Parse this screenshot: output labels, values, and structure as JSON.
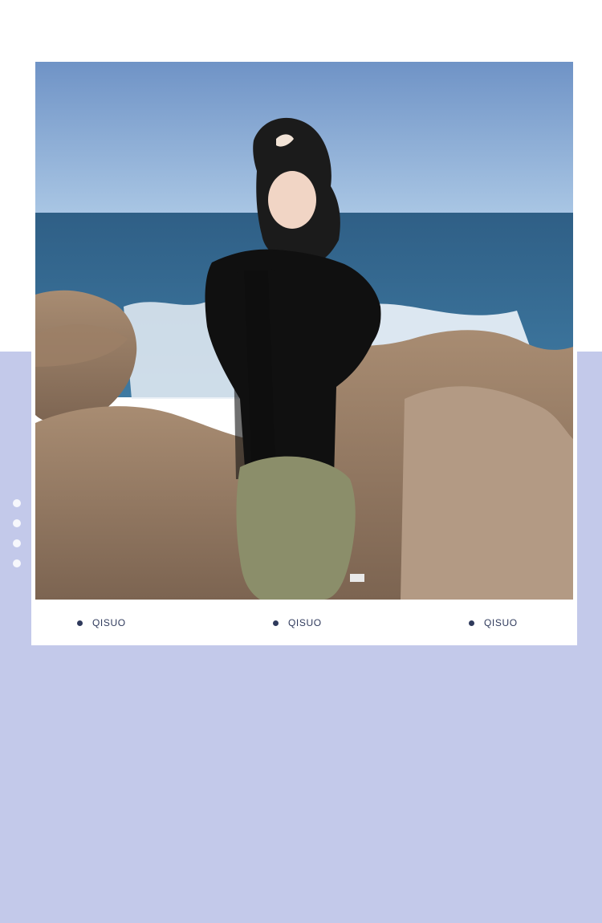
{
  "colors": {
    "background_band": "#c3c9ea",
    "card_background": "#ffffff",
    "brand_text": "#2f3a5c",
    "pager_dot": "#ffffff"
  },
  "photo": {
    "subject": "model-in-black-tshirt-and-olive-shorts-on-seaside-rocks"
  },
  "brand_row": {
    "items": [
      {
        "label": "QISUO"
      },
      {
        "label": "QISUO"
      },
      {
        "label": "QISUO"
      }
    ]
  },
  "pager": {
    "dot_count": 4
  }
}
